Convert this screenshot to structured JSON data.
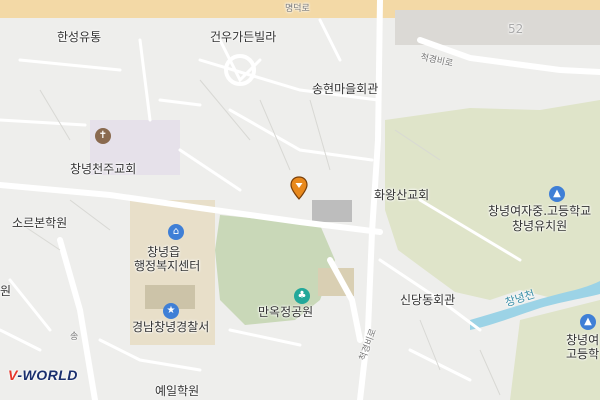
{
  "map": {
    "road_labels": {
      "top_road": "명덕로",
      "road_ne": "척경비로",
      "road_vertical": "척경비로",
      "road_left": "송",
      "road_num": "52"
    },
    "river_label": "창녕천",
    "place_labels": {
      "hanseong": "한성유통",
      "geonwoo": "건우가든빌라",
      "songhyeon": "송현마을회관",
      "catholic": "창녕천주교회",
      "hwawangsan": "화왕산교회",
      "girls_school": "창녕여자중.고등학교",
      "kindergarten": "창녕유치원",
      "sorebon": "소르본학원",
      "welfare_line1": "창녕읍",
      "welfare_line2": "행정복지센터",
      "sindang": "신당동회관",
      "park": "만옥정공원",
      "police": "경남창녕경찰서",
      "girls_right_line1": "창녕여",
      "girls_right_line2": "고등학",
      "yeil": "예일학원",
      "left_edge": "원"
    },
    "marker": {
      "icon": "location-pin-icon"
    },
    "logo_text": {
      "v": "V",
      "rest": "-WORLD"
    },
    "colors": {
      "background": "#eeeeec",
      "road": "#ffffff",
      "main_road": "#f3d9a6",
      "green": "#dfe4c9",
      "park": "#c9d8b8",
      "water": "#9cd3e6",
      "building": "#bdbdbd",
      "pin": "#e8891d",
      "poi_blue": "#3f7fd6",
      "poi_teal": "#22a89a",
      "poi_brown": "#8a6a4f"
    }
  }
}
